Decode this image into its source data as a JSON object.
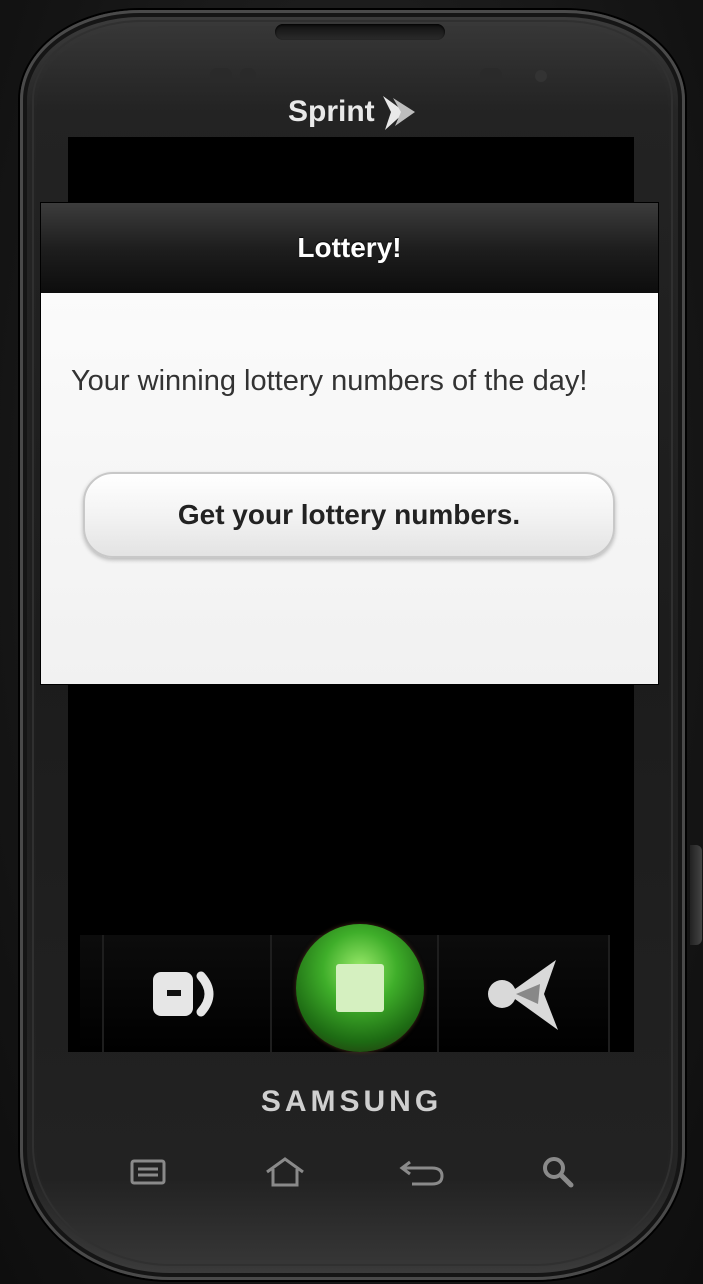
{
  "device": {
    "carrier": "Sprint",
    "brand": "SAMSUNG"
  },
  "dialog": {
    "title": "Lottery!",
    "message": "Your winning lottery numbers of the day!",
    "button_label": "Get your lottery numbers."
  },
  "dock": {
    "items": [
      {
        "icon": "phone-icon"
      },
      {
        "icon": "apps-icon"
      },
      {
        "icon": "share-icon"
      }
    ]
  },
  "hardware_keys": [
    "menu-icon",
    "home-icon",
    "back-icon",
    "search-icon"
  ],
  "colors": {
    "header_bg": "#1e1e1e",
    "body_bg": "#f5f5f5",
    "apps_orb": "#3fae2a"
  }
}
